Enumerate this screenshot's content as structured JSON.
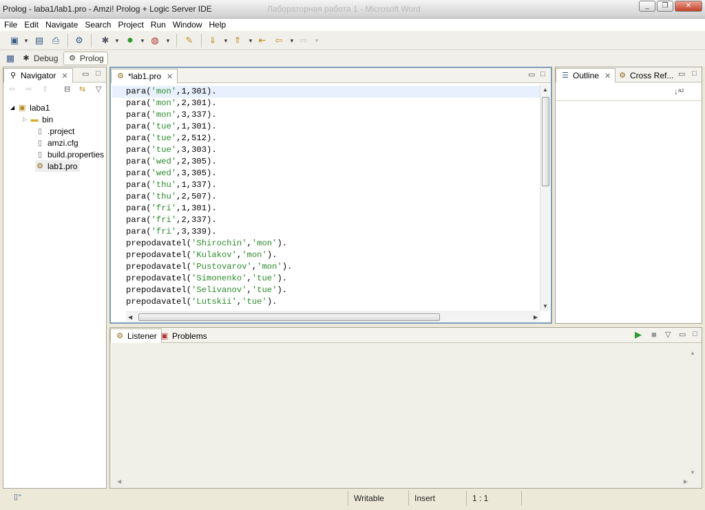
{
  "window": {
    "title": "Prolog - laba1/lab1.pro - Amzi! Prolog + Logic Server IDE",
    "ghost_title": "Лабораторная работа 1 - Microsoft Word"
  },
  "menu": [
    "File",
    "Edit",
    "Navigate",
    "Search",
    "Project",
    "Run",
    "Window",
    "Help"
  ],
  "perspectives": [
    {
      "label": "Debug",
      "icon": "bug-icon"
    },
    {
      "label": "Prolog",
      "icon": "prolog-icon"
    }
  ],
  "navigator": {
    "tab_label": "Navigator",
    "tree": [
      {
        "label": "laba1",
        "icon": "project-icon",
        "level": 0
      },
      {
        "label": "bin",
        "icon": "folder-icon",
        "level": 1
      },
      {
        "label": ".project",
        "icon": "file-icon",
        "level": 1
      },
      {
        "label": "amzi.cfg",
        "icon": "file-icon",
        "level": 1
      },
      {
        "label": "build.properties",
        "icon": "file-icon",
        "level": 1
      },
      {
        "label": "lab1.pro",
        "icon": "prolog-file-icon",
        "level": 1
      }
    ]
  },
  "editor": {
    "tab_label": "*lab1.pro",
    "lines": [
      {
        "pre": "para(",
        "str": "'mon'",
        "post": ",1,301)."
      },
      {
        "pre": "para(",
        "str": "'mon'",
        "post": ",2,301)."
      },
      {
        "pre": "para(",
        "str": "'mon'",
        "post": ",3,337)."
      },
      {
        "pre": "para(",
        "str": "'tue'",
        "post": ",1,301)."
      },
      {
        "pre": "para(",
        "str": "'tue'",
        "post": ",2,512)."
      },
      {
        "pre": "para(",
        "str": "'tue'",
        "post": ",3,303)."
      },
      {
        "pre": "para(",
        "str": "'wed'",
        "post": ",2,305)."
      },
      {
        "pre": "para(",
        "str": "'wed'",
        "post": ",3,305)."
      },
      {
        "pre": "para(",
        "str": "'thu'",
        "post": ",1,337)."
      },
      {
        "pre": "para(",
        "str": "'thu'",
        "post": ",2,507)."
      },
      {
        "pre": "para(",
        "str": "'fri'",
        "post": ",1,301)."
      },
      {
        "pre": "para(",
        "str": "'fri'",
        "post": ",2,337)."
      },
      {
        "pre": "para(",
        "str": "'fri'",
        "post": ",3,339)."
      },
      {
        "pre": "prepodavatel(",
        "str": "'Shirochin'",
        "mid": ",",
        "str2": "'mon'",
        "post": ")."
      },
      {
        "pre": "prepodavatel(",
        "str": "'Kulakov'",
        "mid": ",",
        "str2": "'mon'",
        "post": ")."
      },
      {
        "pre": "prepodavatel(",
        "str": "'Pustovarov'",
        "mid": ",",
        "str2": "'mon'",
        "post": ")."
      },
      {
        "pre": "prepodavatel(",
        "str": "'Simonenko'",
        "mid": ",",
        "str2": "'tue'",
        "post": ")."
      },
      {
        "pre": "prepodavatel(",
        "str": "'Selivanov'",
        "mid": ",",
        "str2": "'tue'",
        "post": ")."
      },
      {
        "pre": "prepodavatel(",
        "str": "'Lutskii'",
        "mid": ",",
        "str2": "'tue'",
        "post": ")."
      }
    ]
  },
  "outline": {
    "tab_label": "Outline",
    "cross_ref_label": "Cross Ref..."
  },
  "console": {
    "listener_label": "Listener",
    "problems_label": "Problems"
  },
  "status": {
    "writable": "Writable",
    "insert": "Insert",
    "position": "1 : 1"
  },
  "colors": {
    "string": "#2a8a2a",
    "current_line": "#e8f0fd",
    "active_view_border": "#7f9db9"
  }
}
